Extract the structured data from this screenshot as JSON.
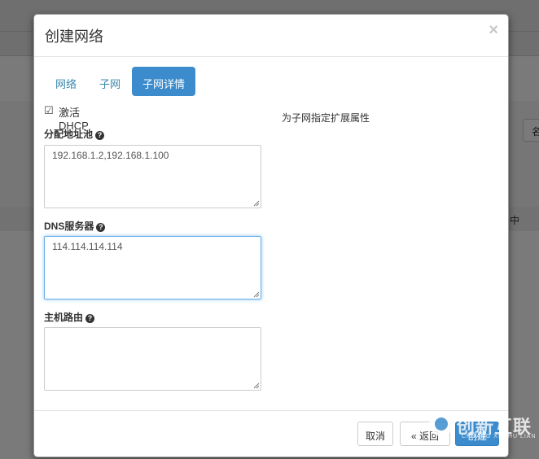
{
  "background": {
    "right_button_label": "名",
    "right_text": "中"
  },
  "modal": {
    "title": "创建网络",
    "close_glyph": "×",
    "tabs": [
      {
        "label": "网络",
        "active": false
      },
      {
        "label": "子网",
        "active": false
      },
      {
        "label": "子网详情",
        "active": true
      }
    ],
    "dhcp": {
      "checked": true,
      "check_glyph": "☑",
      "label": "激活DHCP"
    },
    "fields": {
      "allocation_pools": {
        "label": "分配地址池",
        "value": "192.168.1.2,192.168.1.100"
      },
      "dns_servers": {
        "label": "DNS服务器",
        "value": "114.114.114.114"
      },
      "host_routes": {
        "label": "主机路由",
        "value": ""
      }
    },
    "help_glyph": "?",
    "side_help_text": "为子网指定扩展属性",
    "footer": {
      "cancel_label": "取消",
      "back_label": "« 返回",
      "create_label": "创建"
    }
  },
  "watermark": {
    "text": "创新互联",
    "sub": "CHUANG XIN HU LIAN"
  },
  "colors": {
    "accent": "#3c8ccd",
    "tab_link": "#3a87ad",
    "focus_border": "#66afe9"
  }
}
